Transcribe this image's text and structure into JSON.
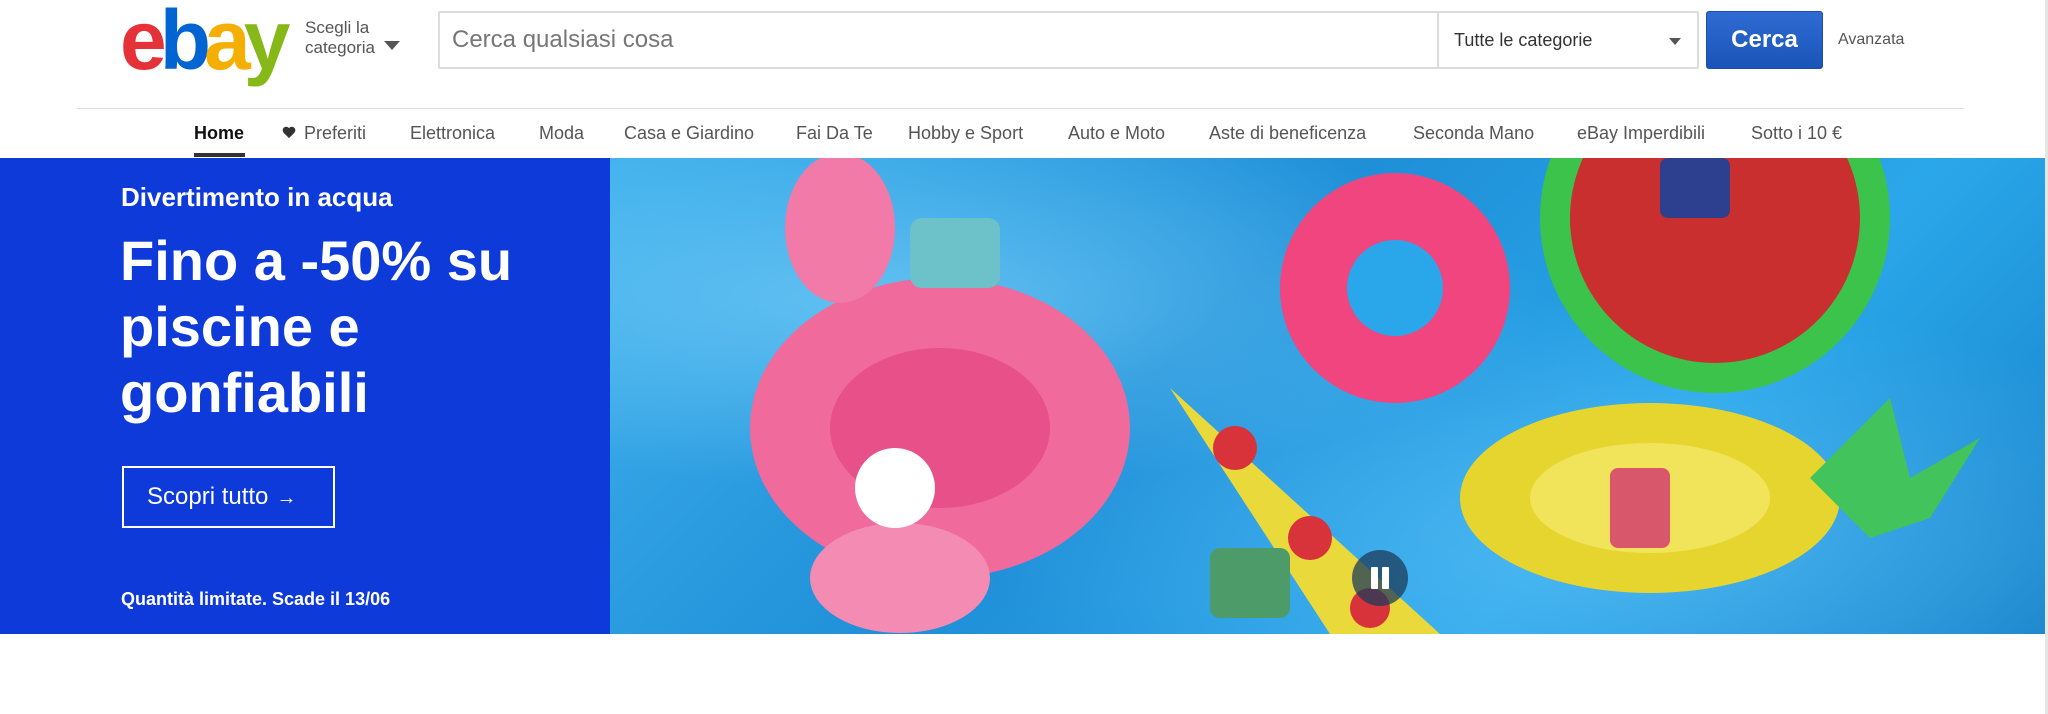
{
  "header": {
    "logo_letters": [
      "e",
      "b",
      "a",
      "y"
    ],
    "category_button": {
      "line1": "Scegli la",
      "line2": "categoria"
    },
    "search": {
      "placeholder": "Cerca qualsiasi cosa",
      "category_selected": "Tutte le categorie",
      "button_label": "Cerca"
    },
    "advanced_label": "Avanzata"
  },
  "nav": {
    "items": [
      {
        "label": "Home",
        "active": true
      },
      {
        "label": "Preferiti",
        "icon": "heart-icon"
      },
      {
        "label": "Elettronica"
      },
      {
        "label": "Moda"
      },
      {
        "label": "Casa e Giardino"
      },
      {
        "label": "Fai Da Te"
      },
      {
        "label": "Hobby e Sport"
      },
      {
        "label": "Auto e Moto"
      },
      {
        "label": "Aste di beneficenza"
      },
      {
        "label": "Seconda Mano"
      },
      {
        "label": "eBay Imperdibili"
      },
      {
        "label": "Sotto i 10 €"
      }
    ]
  },
  "banner": {
    "kicker": "Divertimento in acqua",
    "headline_lines": [
      "Fino a -50% su",
      "piscine e",
      "gonfiabili"
    ],
    "cta_label": "Scopri tutto",
    "cta_arrow": "→",
    "fine_print": "Quantità limitate. Scade il 13/06",
    "image_alt": "Persone su gonfiabili in piscina",
    "promo_color": "#0d3ad9"
  },
  "colors": {
    "logo_e": "#e53238",
    "logo_b": "#0064d2",
    "logo_a": "#f5af02",
    "logo_y": "#86b817",
    "search_button": "#1a54b8"
  }
}
